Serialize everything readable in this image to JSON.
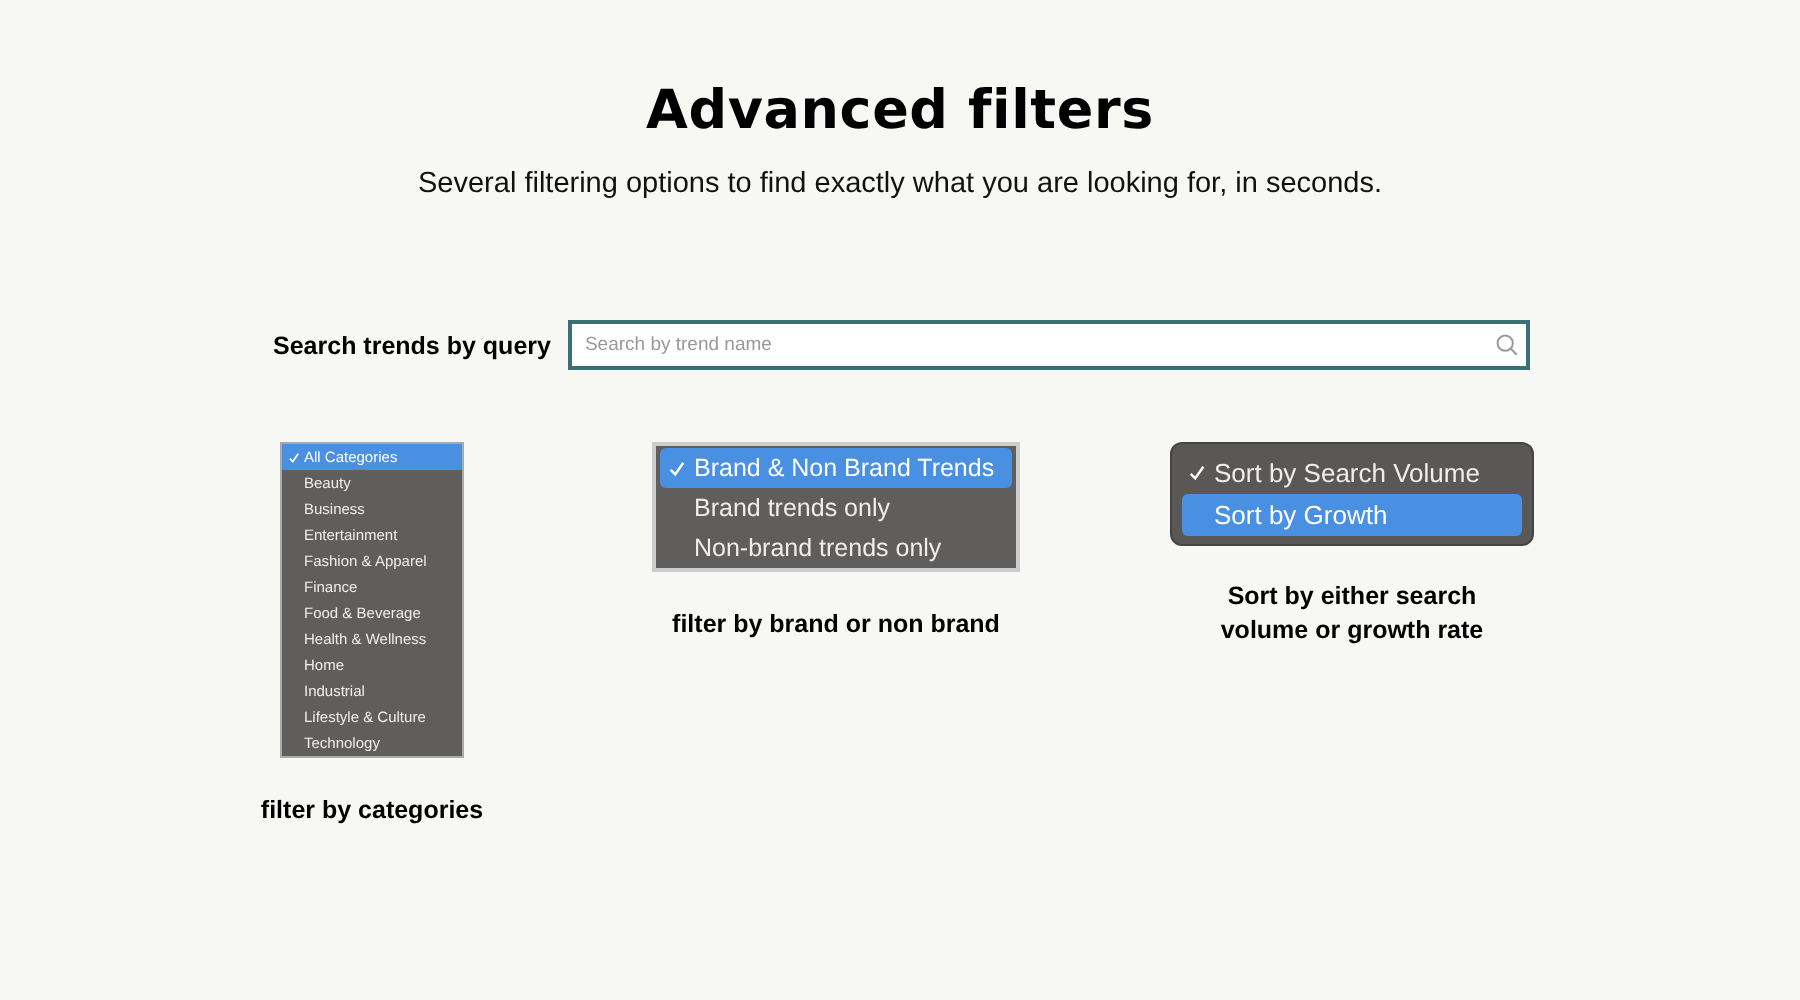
{
  "title": "Advanced filters",
  "subtitle": "Several filtering options to find exactly what you are looking for, in seconds.",
  "search": {
    "label": "Search trends by query",
    "placeholder": "Search by trend name"
  },
  "menus": [
    {
      "caption": "filter by categories",
      "items": [
        {
          "label": "All Categories",
          "checked": true,
          "selected": true
        },
        {
          "label": "Beauty",
          "checked": false,
          "selected": false
        },
        {
          "label": "Business",
          "checked": false,
          "selected": false
        },
        {
          "label": "Entertainment",
          "checked": false,
          "selected": false
        },
        {
          "label": "Fashion & Apparel",
          "checked": false,
          "selected": false
        },
        {
          "label": "Finance",
          "checked": false,
          "selected": false
        },
        {
          "label": "Food & Beverage",
          "checked": false,
          "selected": false
        },
        {
          "label": "Health & Wellness",
          "checked": false,
          "selected": false
        },
        {
          "label": "Home",
          "checked": false,
          "selected": false
        },
        {
          "label": "Industrial",
          "checked": false,
          "selected": false
        },
        {
          "label": "Lifestyle & Culture",
          "checked": false,
          "selected": false
        },
        {
          "label": "Technology",
          "checked": false,
          "selected": false
        }
      ]
    },
    {
      "caption": "filter by brand or non brand",
      "items": [
        {
          "label": "Brand & Non Brand Trends",
          "checked": true,
          "selected": true
        },
        {
          "label": "Brand trends only",
          "checked": false,
          "selected": false
        },
        {
          "label": "Non-brand trends only",
          "checked": false,
          "selected": false
        }
      ]
    },
    {
      "caption": "Sort by either search volume or growth rate",
      "items": [
        {
          "label": "Sort by Search Volume",
          "checked": true,
          "selected": false
        },
        {
          "label": "Sort by Growth",
          "checked": false,
          "selected": true
        }
      ]
    }
  ]
}
